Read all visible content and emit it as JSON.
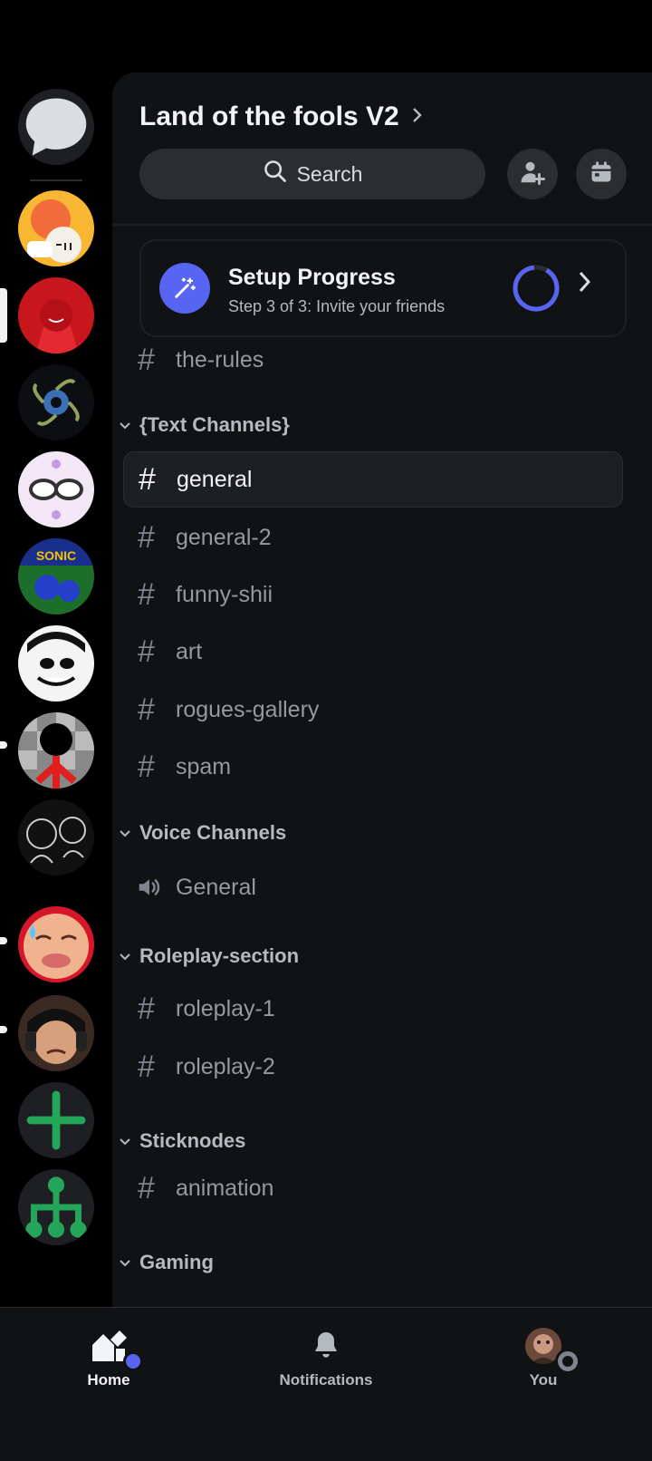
{
  "server": {
    "name": "Land of the fools V2"
  },
  "search": {
    "label": "Search"
  },
  "setup": {
    "title": "Setup Progress",
    "subtitle": "Step 3 of 3: Invite your friends"
  },
  "top_channel": {
    "name": "the-rules"
  },
  "categories": {
    "text": {
      "label": "{Text Channels}",
      "channels": [
        "general",
        "general-2",
        "funny-shii",
        "art",
        "rogues-gallery",
        "spam"
      ]
    },
    "voice": {
      "label": "Voice Channels",
      "channels": [
        "General"
      ]
    },
    "roleplay": {
      "label": "Roleplay-section",
      "channels": [
        "roleplay-1",
        "roleplay-2"
      ]
    },
    "sticknodes": {
      "label": "Sticknodes",
      "channels": [
        "animation"
      ]
    },
    "gaming": {
      "label": "Gaming"
    }
  },
  "nav": {
    "home": "Home",
    "notifications": "Notifications",
    "you": "You"
  },
  "colors": {
    "brand": "#5865f2",
    "green": "#23a55a",
    "background": "#000000",
    "panel": "#111214"
  }
}
